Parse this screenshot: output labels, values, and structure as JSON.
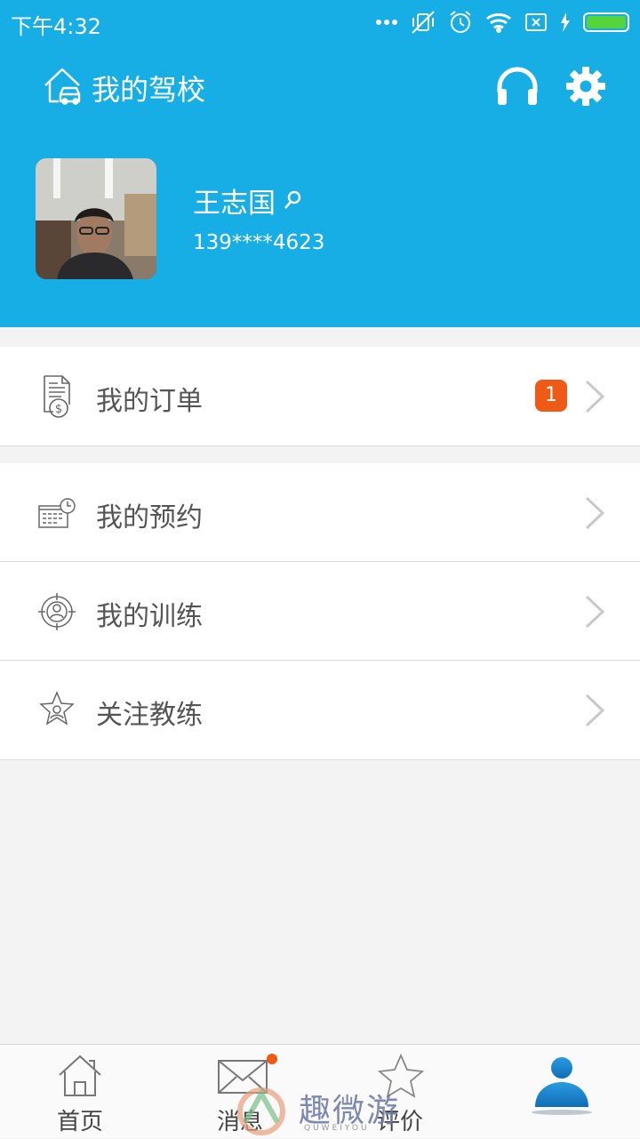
{
  "status_bar": {
    "time": "下午4:32",
    "icons": [
      "more-dots-icon",
      "vibrate-off-icon",
      "alarm-icon",
      "wifi-icon",
      "sim-off-icon",
      "charging-icon",
      "battery-icon"
    ]
  },
  "header": {
    "title": "我的驾校",
    "title_icon": "driving-school-home-icon",
    "support_icon": "headset-icon",
    "settings_icon": "gear-icon",
    "bg_color": "#17aee6"
  },
  "profile": {
    "name": "王志国",
    "phone": "139****4623",
    "avatar_icon": "avatar"
  },
  "menu": {
    "orders": {
      "label": "我的订单",
      "badge": "1",
      "icon": "invoice-dollar-icon"
    },
    "items": [
      {
        "label": "我的预约",
        "icon": "calendar-clock-icon"
      },
      {
        "label": "我的训练",
        "icon": "target-person-icon"
      },
      {
        "label": "关注教练",
        "icon": "star-person-icon"
      }
    ]
  },
  "bottom_nav": {
    "items": [
      {
        "label": "首页",
        "icon": "home-icon"
      },
      {
        "label": "消息",
        "icon": "mail-icon",
        "has_dot": true
      },
      {
        "label": "评价",
        "icon": "star-icon"
      },
      {
        "label": "",
        "icon": "user-icon",
        "active": true
      }
    ],
    "accent": "#1a8fd6"
  },
  "watermark": {
    "text": "趣微游",
    "sub": "QUWEIYOU"
  }
}
